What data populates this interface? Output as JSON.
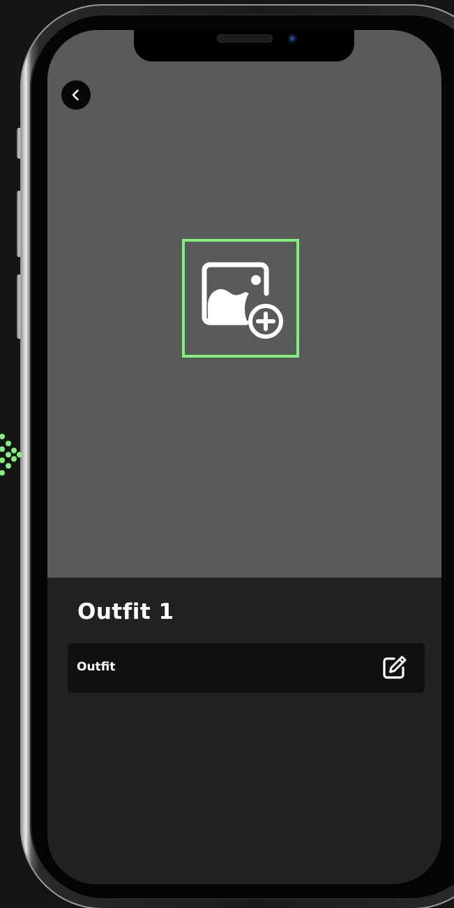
{
  "screen": {
    "title": "Outfit 1",
    "item_label": "Outfit"
  },
  "icons": {
    "back": "chevron-left-icon",
    "add_photo": "image-add-icon",
    "edit": "edit-icon"
  },
  "colors": {
    "accent": "#7ef27a",
    "hero_bg": "#5a5a5a",
    "panel_bg": "#222222",
    "row_bg": "#101010",
    "text": "#ffffff"
  }
}
